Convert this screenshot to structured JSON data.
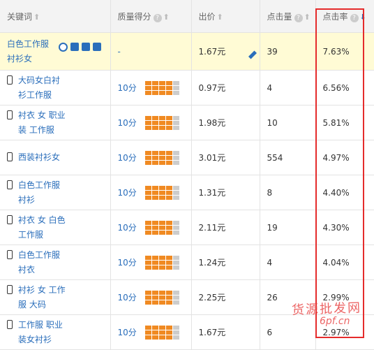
{
  "headers": {
    "keyword": "关键词",
    "quality": "质量得分",
    "price": "出价",
    "clicks": "点击量",
    "ctr": "点击率"
  },
  "rows": [
    {
      "keyword": "白色工作服衬衫女",
      "score": "-",
      "price": "1.67元",
      "clicks": "39",
      "ctr": "7.63%",
      "mobile": false
    },
    {
      "keyword": "大码女白衬衫工作服",
      "score": "10分",
      "price": "0.97元",
      "clicks": "4",
      "ctr": "6.56%",
      "mobile": true
    },
    {
      "keyword": "衬衣 女 职业装 工作服",
      "score": "10分",
      "price": "1.98元",
      "clicks": "10",
      "ctr": "5.81%",
      "mobile": true
    },
    {
      "keyword": "西装衬衫女",
      "score": "10分",
      "price": "3.01元",
      "clicks": "554",
      "ctr": "4.97%",
      "mobile": true
    },
    {
      "keyword": "白色工作服衬衫",
      "score": "10分",
      "price": "1.31元",
      "clicks": "8",
      "ctr": "4.40%",
      "mobile": true
    },
    {
      "keyword": "衬衣 女 白色 工作服",
      "score": "10分",
      "price": "2.11元",
      "clicks": "19",
      "ctr": "4.30%",
      "mobile": true
    },
    {
      "keyword": "白色工作服衬衣",
      "score": "10分",
      "price": "1.24元",
      "clicks": "4",
      "ctr": "4.04%",
      "mobile": true
    },
    {
      "keyword": "衬衫 女 工作服 大码",
      "score": "10分",
      "price": "2.25元",
      "clicks": "26",
      "ctr": "2.99%",
      "mobile": true
    },
    {
      "keyword": "工作服 职业装女衬衫",
      "score": "10分",
      "price": "1.67元",
      "clicks": "6",
      "ctr": "2.97%",
      "mobile": true
    }
  ],
  "watermark": {
    "line1": "货源批发网",
    "line2": "6pf.cn"
  },
  "colors": {
    "link": "#2a6ebb",
    "bar": "#f08a22",
    "highlight_box": "#e52b2b"
  }
}
